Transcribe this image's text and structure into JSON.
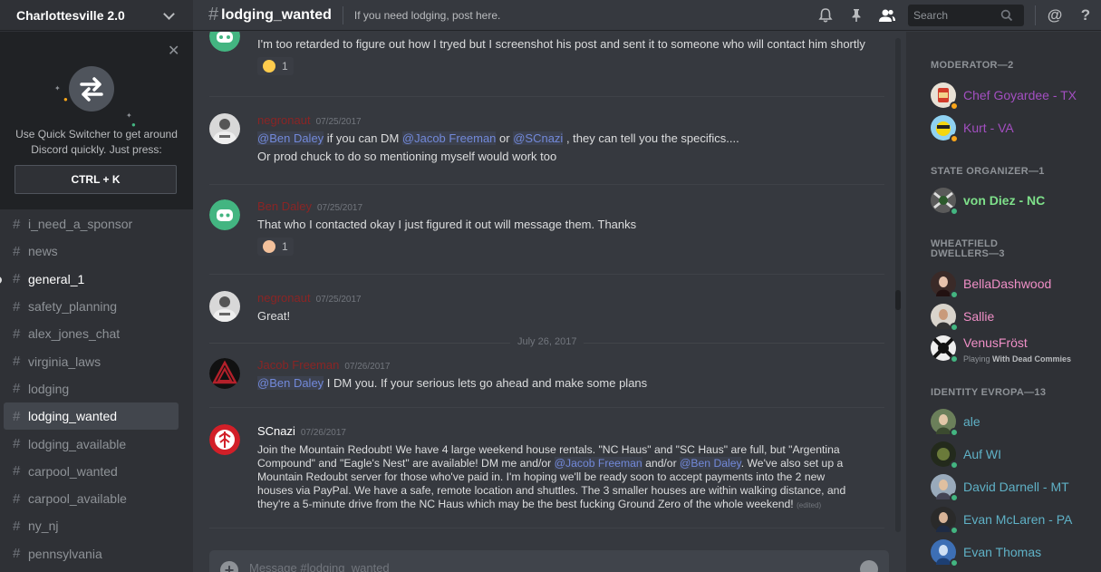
{
  "server": {
    "name": "Charlottesville 2.0"
  },
  "quick_switcher": {
    "text": "Use Quick Switcher to get around Discord quickly. Just press:",
    "shortcut": "CTRL + K"
  },
  "channels": [
    {
      "name": "i_need_a_sponsor",
      "state": "normal"
    },
    {
      "name": "news",
      "state": "normal"
    },
    {
      "name": "general_1",
      "state": "unread"
    },
    {
      "name": "safety_planning",
      "state": "normal"
    },
    {
      "name": "alex_jones_chat",
      "state": "normal"
    },
    {
      "name": "virginia_laws",
      "state": "normal"
    },
    {
      "name": "lodging",
      "state": "normal"
    },
    {
      "name": "lodging_wanted",
      "state": "active"
    },
    {
      "name": "lodging_available",
      "state": "normal"
    },
    {
      "name": "carpool_wanted",
      "state": "normal"
    },
    {
      "name": "carpool_available",
      "state": "normal"
    },
    {
      "name": "ny_nj",
      "state": "normal"
    },
    {
      "name": "pennsylvania",
      "state": "normal"
    }
  ],
  "header": {
    "hash": "#",
    "channel": "lodging_wanted",
    "topic": "If you need lodging, post here.",
    "search_placeholder": "Search",
    "at_label": "@",
    "help_label": "?"
  },
  "messages": {
    "m0": {
      "line1": "I'm too retarded to figure out how I tryed but I screenshot his post and sent it to someone who will contact him shortly",
      "reaction_count": "1"
    },
    "m1": {
      "author": "negronaut",
      "time": "07/25/2017",
      "l1_mention1": "@Ben Daley",
      "l1_t1": " if you can DM ",
      "l1_mention2": "@Jacob Freeman",
      "l1_t2": " or ",
      "l1_mention3": "@SCnazi",
      "l1_t3": " , they can tell you the specifics....",
      "line2": "Or prod chuck to do so mentioning myself would work too"
    },
    "m2": {
      "author": "Ben Daley",
      "time": "07/25/2017",
      "line1": "That who I contacted okay I just figured it out will message them. Thanks",
      "reaction_count": "1"
    },
    "m3": {
      "author": "negronaut",
      "time": "07/25/2017",
      "line1": "Great!"
    },
    "date_divider": "July 26, 2017",
    "m4": {
      "author": "Jacob Freeman",
      "time": "07/26/2017",
      "mention": "@Ben Daley",
      "text": " I DM you. If your serious lets go ahead and make some plans"
    },
    "m5": {
      "author": "SCnazi",
      "time": "07/26/2017",
      "l1": "Join the Mountain Redoubt! We have 4 large weekend house rentals. \"NC Haus\" and \"SC Haus\" are full, but \"Argentina",
      "l2a": "Compound\" and \"Eagle's Nest\" are available! DM me and/or ",
      "l2_m1": "@Jacob Freeman",
      "l2b": " and/or ",
      "l2_m2": "@Ben Daley",
      "l2c": ". We've also set up a",
      "l3": "Mountain Redoubt server for those who've paid in. I'm hoping we'll be ready soon to accept payments into the 2 new",
      "l4": "houses via PayPal. We have a safe, remote location and shuttles. The 3 smaller houses are within walking distance, and",
      "l5": "they're a 5-minute drive from the NC Haus which may be the best fucking Ground Zero of the whole weekend!",
      "edited": "(edited)"
    }
  },
  "composer": {
    "placeholder": "Message #lodging_wanted"
  },
  "members": {
    "moderator_header": "MODERATOR—2",
    "moderators": [
      {
        "name": "Chef Goyardee - TX"
      },
      {
        "name": "Kurt - VA"
      }
    ],
    "state_header": "STATE ORGANIZER—1",
    "state": [
      {
        "name": "von Diez - NC"
      }
    ],
    "wheatfield_header_1": "WHEATFIELD",
    "wheatfield_header_2": "DWELLERS—3",
    "wheatfield": [
      {
        "name": "BellaDashwood"
      },
      {
        "name": "Sallie"
      },
      {
        "name": "VenusFröst",
        "playing": "Playing",
        "game": "With Dead Commies"
      }
    ],
    "identity_header": "IDENTITY EVROPA—13",
    "identity": [
      {
        "name": "ale"
      },
      {
        "name": "Auf WI"
      },
      {
        "name": "David Darnell - MT"
      },
      {
        "name": "Evan McLaren - PA"
      },
      {
        "name": "Evan Thomas"
      }
    ]
  },
  "colors": {
    "moderator": "#a34fc1",
    "state_organizer": "#7ee08a",
    "wheatfield": "#f08fc7",
    "identity": "#5fb1c6",
    "negronaut": "#8a2525",
    "online": "#43b581",
    "idle": "#faa61a"
  }
}
